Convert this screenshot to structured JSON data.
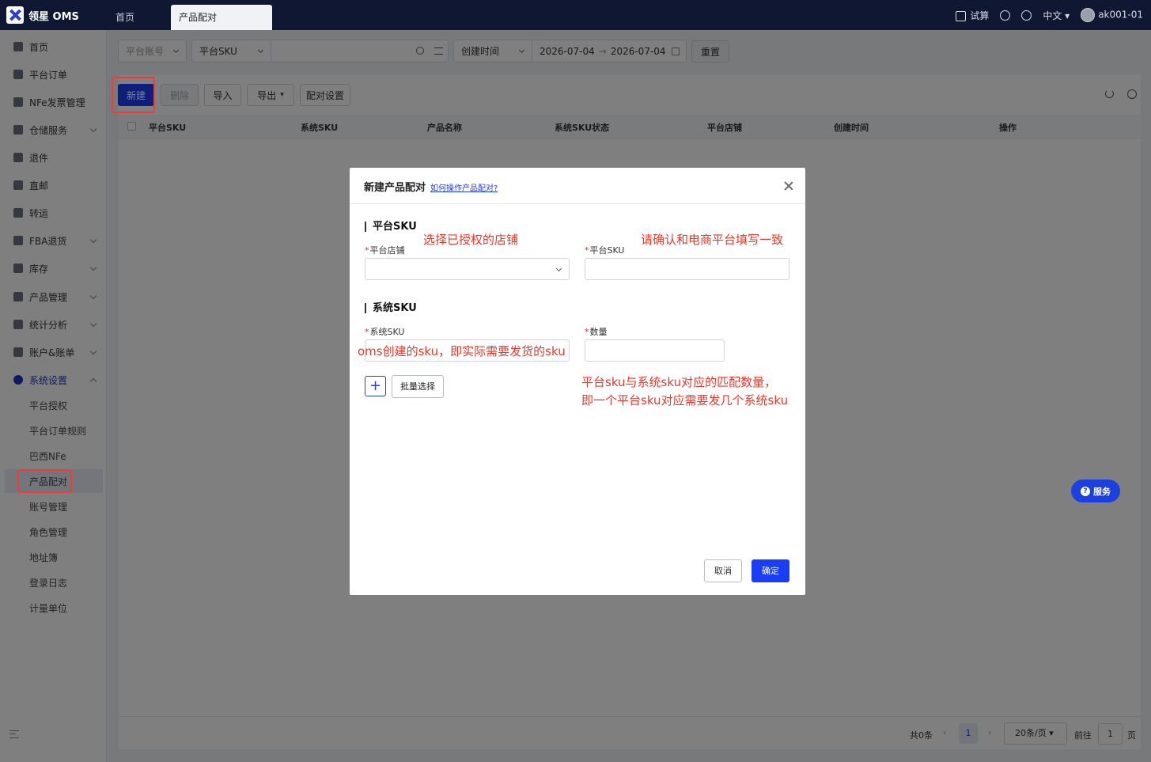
{
  "app": {
    "logo": "领星 OMS"
  },
  "tabs": {
    "home": "首页",
    "active": "产品配对"
  },
  "topbar": {
    "trial": "试算",
    "language": "中文",
    "user": "ak001-01"
  },
  "sidebar": {
    "items": [
      {
        "label": "首页"
      },
      {
        "label": "平台订单"
      },
      {
        "label": "NFe发票管理"
      },
      {
        "label": "仓储服务"
      },
      {
        "label": "退件"
      },
      {
        "label": "直邮"
      },
      {
        "label": "转运"
      },
      {
        "label": "FBA退货"
      },
      {
        "label": "库存"
      },
      {
        "label": "产品管理"
      },
      {
        "label": "统计分析"
      },
      {
        "label": "账户&账单"
      },
      {
        "label": "系统设置"
      }
    ],
    "sub_items": [
      {
        "label": "平台授权"
      },
      {
        "label": "平台订单规则"
      },
      {
        "label": "巴西NFe"
      },
      {
        "label": "产品配对"
      },
      {
        "label": "账号管理"
      },
      {
        "label": "角色管理"
      },
      {
        "label": "地址簿"
      },
      {
        "label": "登录日志"
      },
      {
        "label": "计量单位"
      }
    ]
  },
  "filters": {
    "platform_account": "平台账号",
    "sku_type": "平台SKU",
    "time_type": "创建时间",
    "date_start": "2026-07-04",
    "date_end": "2026-07-04",
    "reset": "重置"
  },
  "toolbar": {
    "new": "新建",
    "delete": "删除",
    "import": "导入",
    "export": "导出",
    "pair_settings": "配对设置"
  },
  "table": {
    "columns": [
      "平台SKU",
      "系统SKU",
      "产品名称",
      "系统SKU状态",
      "平台店铺",
      "创建时间",
      "操作"
    ]
  },
  "modal": {
    "title": "新建产品配对",
    "help_link": "如何操作产品配对?",
    "section_platform": "平台SKU",
    "label_store": "平台店铺",
    "label_platform_sku": "平台SKU",
    "section_system": "系统SKU",
    "label_system_sku": "系统SKU",
    "label_quantity": "数量",
    "bulk_select": "批量选择",
    "cancel": "取消",
    "confirm": "确定"
  },
  "annotations": {
    "store_hint": "选择已授权的店铺",
    "platform_sku_hint": "请确认和电商平台填写一致",
    "system_sku_hint": "oms创建的sku，即实际需要发货的sku",
    "quantity_hint_1": "平台sku与系统sku对应的匹配数量，",
    "quantity_hint_2": "即一个平台sku对应需要发几个系统sku"
  },
  "service": "服务",
  "pager": {
    "total": "共0条",
    "page": "1",
    "page_size": "20条/页",
    "goto_label": "前往",
    "goto_value": "1",
    "page_suffix": "页"
  }
}
